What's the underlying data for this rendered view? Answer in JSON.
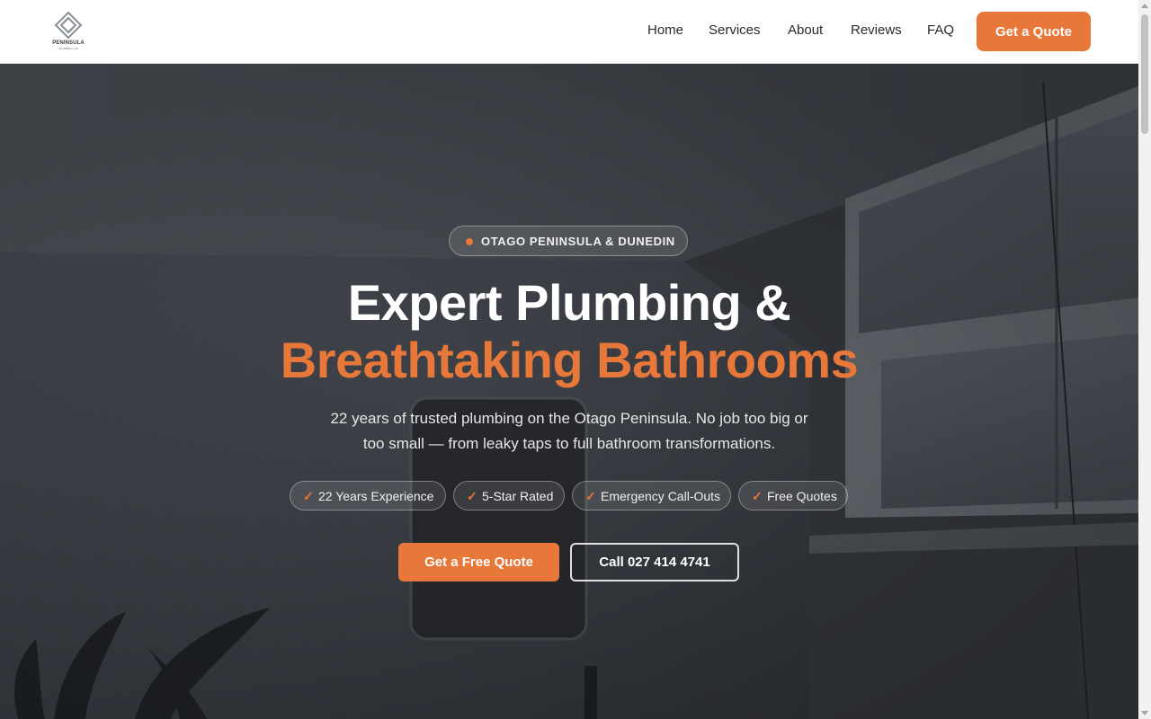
{
  "brand": {
    "logo_text": "PENINSULA",
    "logo_subtext": "PLUMBING LTD",
    "accent_color": "#e8783a"
  },
  "nav": {
    "items": [
      {
        "label": "Home"
      },
      {
        "label": "Services"
      },
      {
        "label": "About"
      },
      {
        "label": "Reviews"
      },
      {
        "label": "FAQ"
      }
    ],
    "cta_label": "Get a Quote"
  },
  "hero": {
    "tag": "OTAGO PENINSULA & DUNEDIN",
    "heading_line1": "Expert Plumbing &",
    "heading_line2": "Breathtaking Bathrooms",
    "subheading": "22 years of trusted plumbing on the Otago Peninsula. No job too big or too small — from leaky taps to full bathroom transformations.",
    "badges": [
      {
        "icon": "check-icon",
        "label": "22 Years Experience"
      },
      {
        "icon": "check-icon",
        "label": "5-Star Rated"
      },
      {
        "icon": "check-icon",
        "label": "Emergency Call-Outs"
      },
      {
        "icon": "check-icon",
        "label": "Free Quotes"
      }
    ],
    "primary_cta": "Get a Free Quote",
    "secondary_cta": "Call 027 414 4741"
  }
}
